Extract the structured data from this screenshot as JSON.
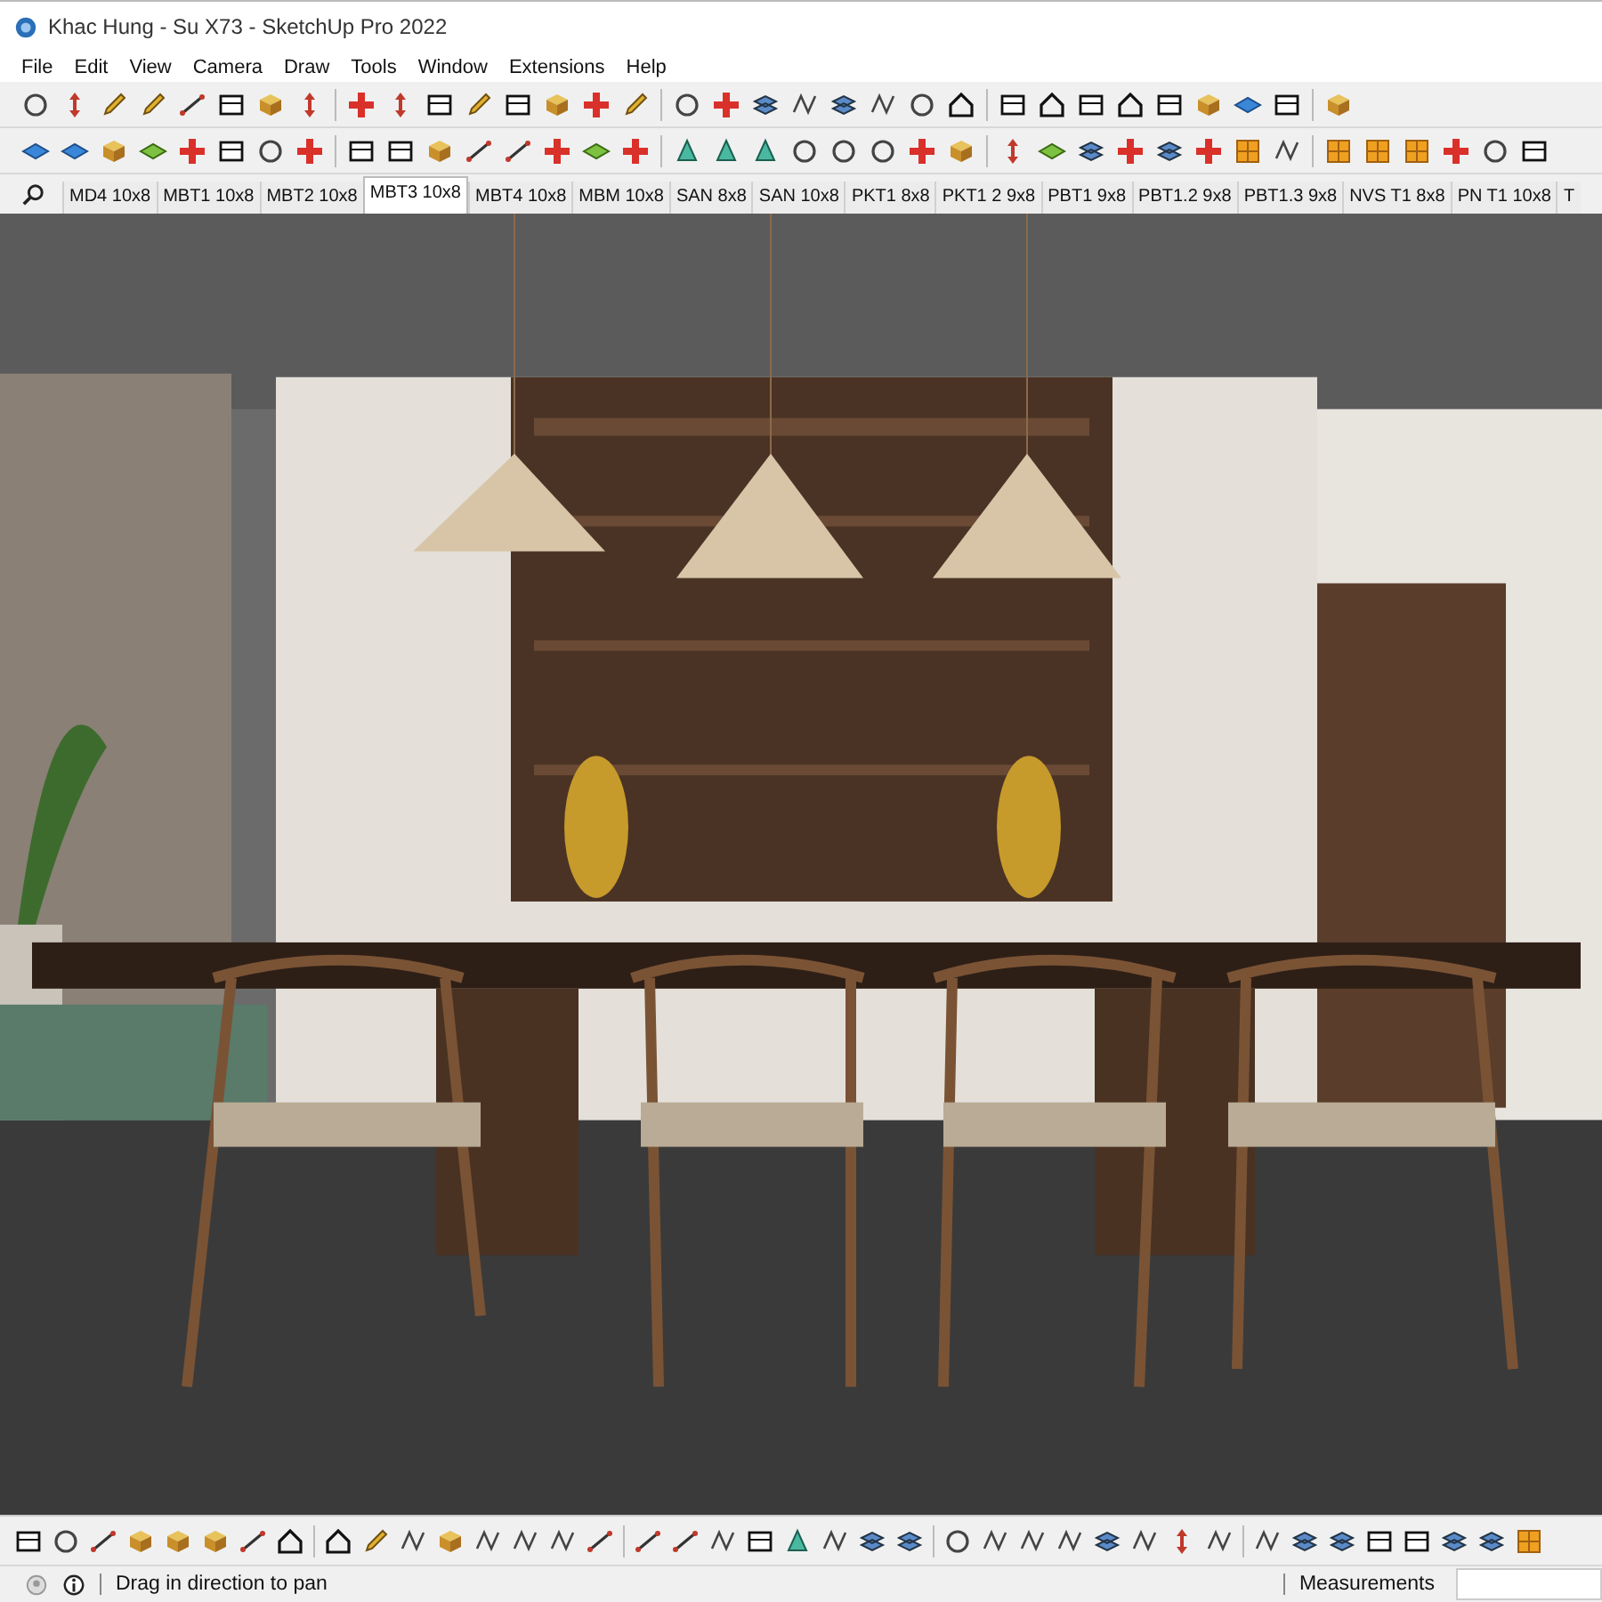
{
  "window": {
    "title": "Khac Hung - Su X73 - SketchUp Pro 2022"
  },
  "menu": [
    "File",
    "Edit",
    "View",
    "Camera",
    "Draw",
    "Tools",
    "Window",
    "Extensions",
    "Help"
  ],
  "scene_tabs": [
    {
      "label": "MD4 10x8",
      "selected": false
    },
    {
      "label": "MBT1 10x8",
      "selected": false
    },
    {
      "label": "MBT2 10x8",
      "selected": false
    },
    {
      "label": "MBT3 10x8",
      "selected": true
    },
    {
      "label": "MBT4 10x8",
      "selected": false
    },
    {
      "label": "MBM 10x8",
      "selected": false
    },
    {
      "label": "SAN 8x8",
      "selected": false
    },
    {
      "label": "SAN 10x8",
      "selected": false
    },
    {
      "label": "PKT1 8x8",
      "selected": false
    },
    {
      "label": "PKT1 2 9x8",
      "selected": false
    },
    {
      "label": "PBT1 9x8",
      "selected": false
    },
    {
      "label": "PBT1.2 9x8",
      "selected": false
    },
    {
      "label": "PBT1.3 9x8",
      "selected": false
    },
    {
      "label": "NVS T1 8x8",
      "selected": false
    },
    {
      "label": "PN T1 10x8",
      "selected": false
    },
    {
      "label": "T",
      "selected": false
    }
  ],
  "status_bar": {
    "hint": "Drag in direction to pan",
    "measurements_label": "Measurements"
  }
}
